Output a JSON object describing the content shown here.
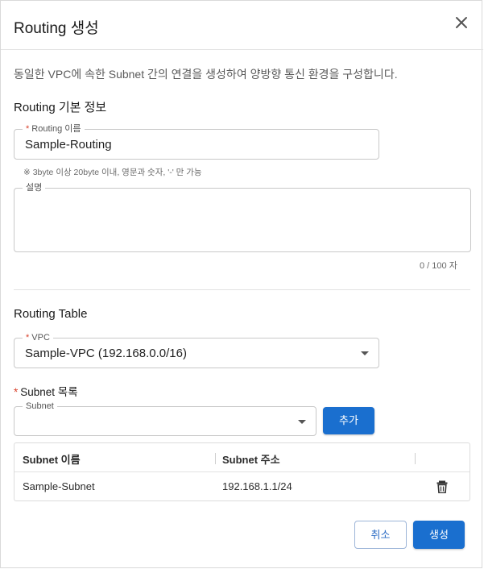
{
  "dialog": {
    "title": "Routing 생성",
    "close_icon": "close-icon",
    "description": "동일한 VPC에 속한 Subnet 간의 연결을 생성하여 양방향 통신 환경을 구성합니다."
  },
  "basic_info": {
    "section_title": "Routing 기본 정보",
    "routing_name": {
      "label": "Routing 이름",
      "required_mark": "*",
      "value": "Sample-Routing",
      "hint": "※ 3byte 이상 20byte 이내, 영문과 숫자, '-' 만 가능"
    },
    "description_field": {
      "label": "설명",
      "value": "",
      "counter": "0 / 100 자"
    }
  },
  "routing_table": {
    "section_title": "Routing Table",
    "vpc": {
      "label": "VPC",
      "required_mark": "*",
      "value": "Sample-VPC (192.168.0.0/16)"
    },
    "subnet_list": {
      "label": "Subnet 목록",
      "required_mark": "*",
      "select_label": "Subnet",
      "select_value": "",
      "add_button": "추가",
      "columns": [
        "Subnet 이름",
        "Subnet 주소"
      ],
      "rows": [
        {
          "name": "Sample-Subnet",
          "address": "192.168.1.1/24",
          "action_icon": "trash-icon"
        }
      ]
    }
  },
  "footer": {
    "cancel_button": "취소",
    "create_button": "생성"
  },
  "colors": {
    "primary": "#1a6fcf",
    "required": "#d9432e",
    "border": "#c8c8c8"
  }
}
